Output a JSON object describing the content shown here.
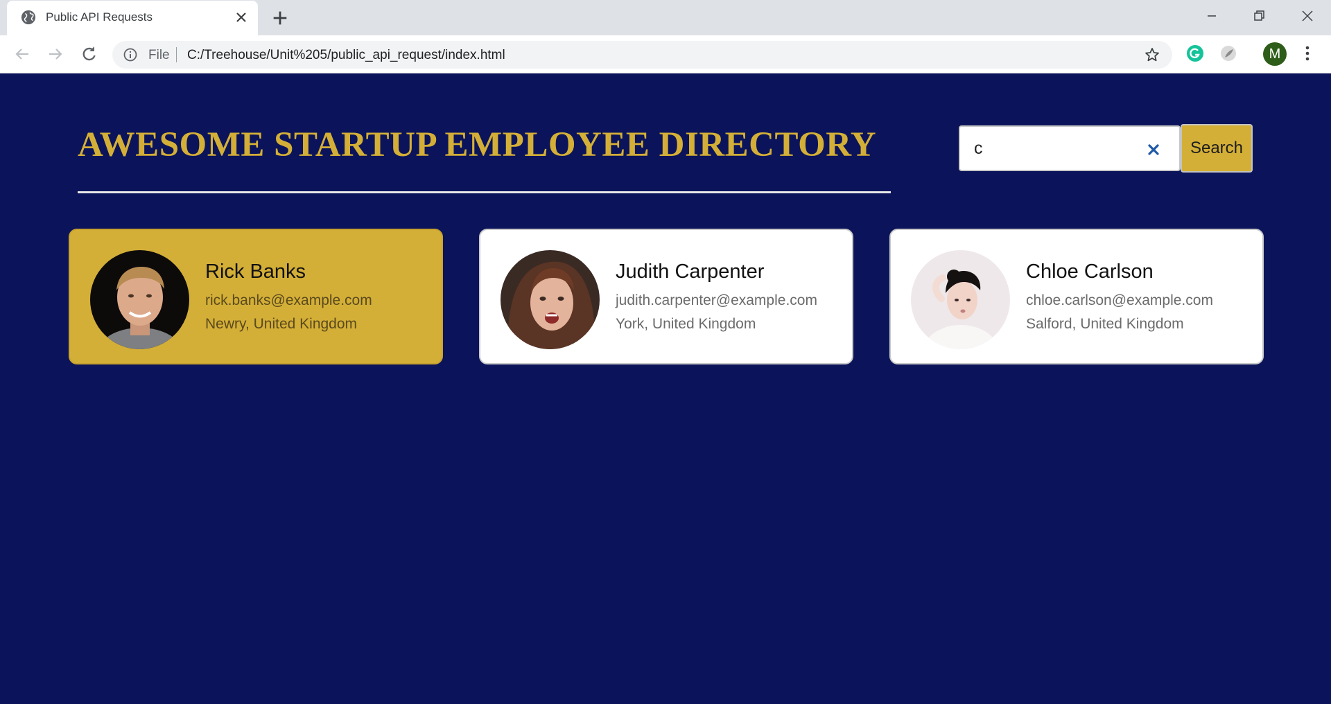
{
  "browser": {
    "tab_title": "Public API Requests",
    "omnibox_scheme": "File",
    "url": "C:/Treehouse/Unit%205/public_api_request/index.html",
    "profile_initial": "M"
  },
  "page": {
    "heading": "AWESOME STARTUP EMPLOYEE DIRECTORY",
    "search": {
      "value": "c",
      "button_label": "Search"
    },
    "employees": [
      {
        "name": "Rick Banks",
        "email": "rick.banks@example.com",
        "location": "Newry, United Kingdom",
        "highlighted": true
      },
      {
        "name": "Judith Carpenter",
        "email": "judith.carpenter@example.com",
        "location": "York, United Kingdom",
        "highlighted": false
      },
      {
        "name": "Chloe Carlson",
        "email": "chloe.carlson@example.com",
        "location": "Salford, United Kingdom",
        "highlighted": false
      }
    ]
  },
  "colors": {
    "page_background": "#0b145a",
    "accent_gold": "#d4af37",
    "card_background": "#ffffff"
  },
  "icons": [
    "globe-icon",
    "close-icon",
    "plus-icon",
    "minimize-icon",
    "restore-icon",
    "window-close-icon",
    "back-arrow-icon",
    "forward-arrow-icon",
    "reload-icon",
    "info-icon",
    "star-icon",
    "grammarly-icon",
    "extension-icon",
    "more-vert-icon",
    "clear-search-icon"
  ]
}
